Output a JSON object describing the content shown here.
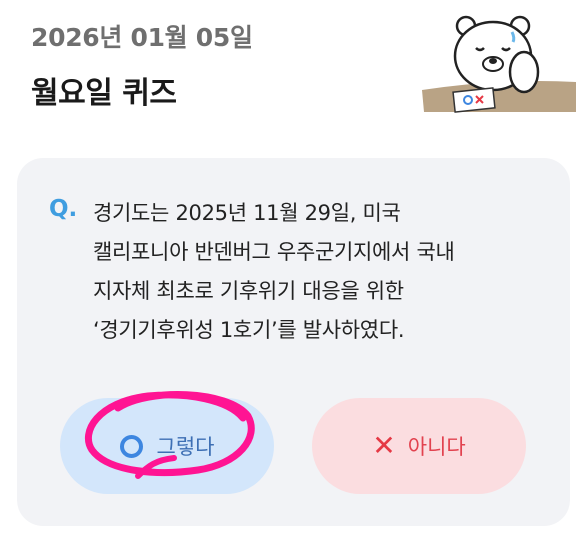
{
  "header": {
    "date": "2026년 01월 05일",
    "title": "월요일 퀴즈"
  },
  "quiz": {
    "marker": "Q.",
    "question_lines": [
      "경기도는 2025년 11월 29일, 미국",
      "캘리포니아 반덴버그 우주군기지에서 국내",
      "지자체 최초로 기후위기 대응을 위한",
      "‘경기기후위성 1호기’를 발사하였다."
    ]
  },
  "answers": {
    "yes_label": "그렇다",
    "no_label": "아니다",
    "yes_icon": "circle-o-icon",
    "no_icon": "x-icon"
  },
  "colors": {
    "accent_blue": "#3f9de0",
    "yes_bg": "#d3e6fb",
    "no_bg": "#fbdde0",
    "no_fg": "#e2424f",
    "highlight_scribble": "#ff1493"
  }
}
